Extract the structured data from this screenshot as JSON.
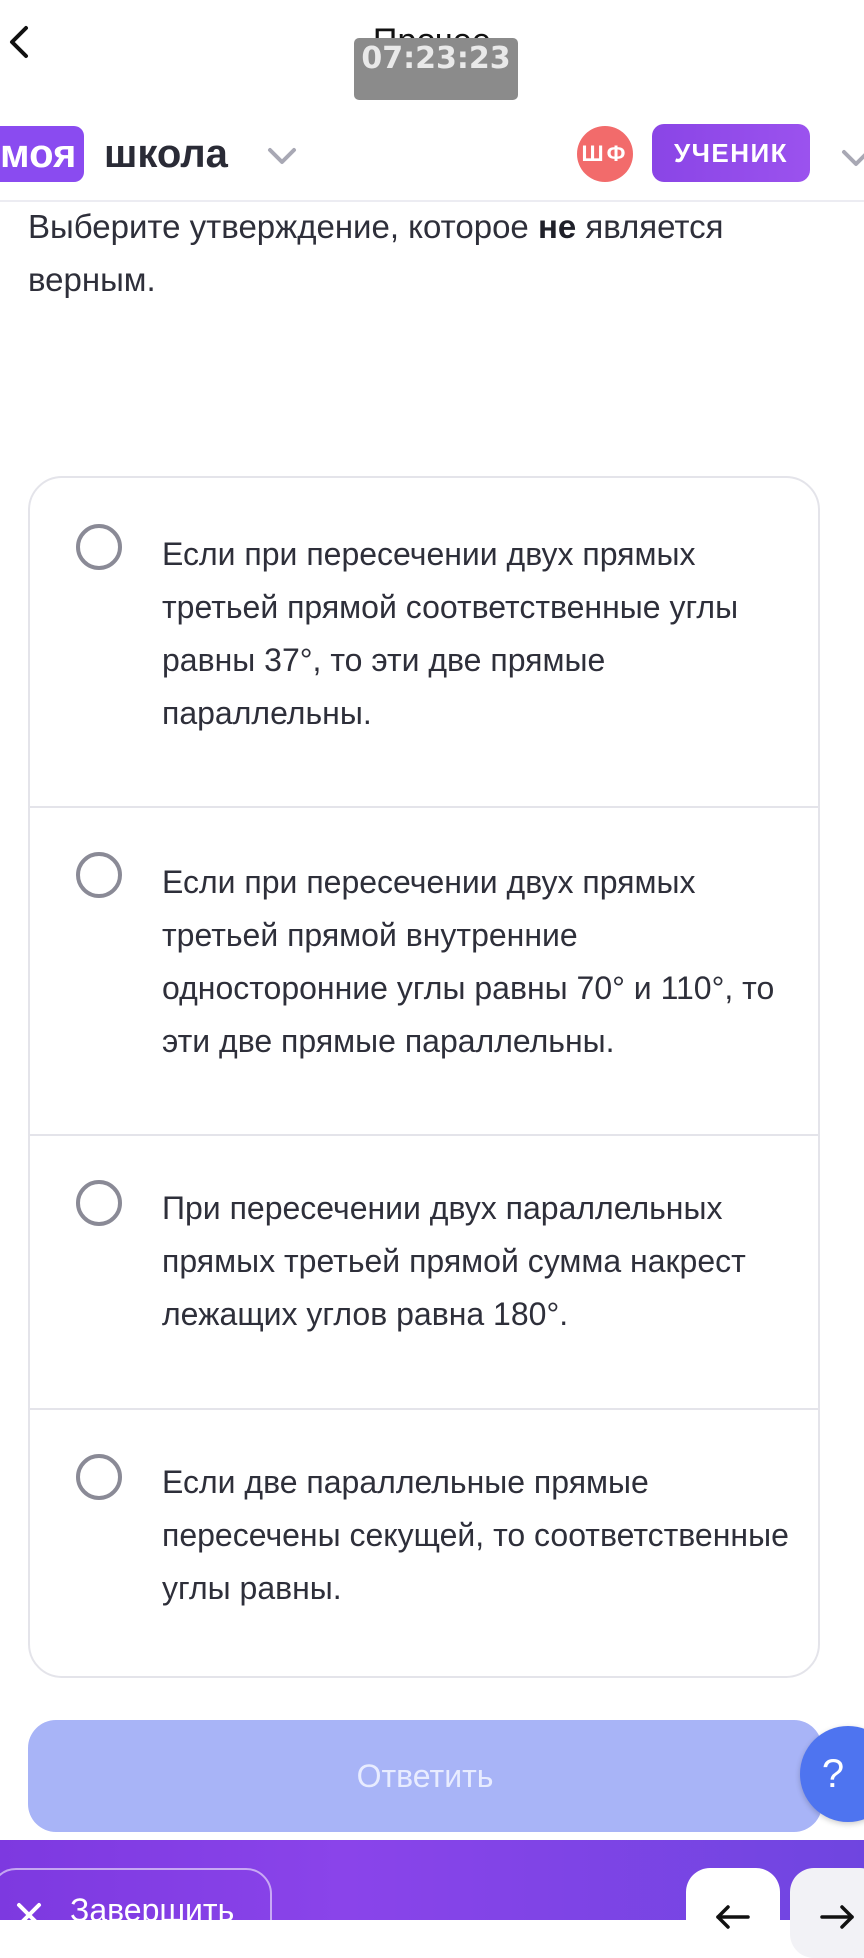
{
  "topbar": {
    "title": "Прочее",
    "timer": "07:23:23"
  },
  "header": {
    "logo_badge": "моя",
    "logo_rest": "школа",
    "avatar_initials": "ШФ",
    "role_label": "УЧЕНИК"
  },
  "question": {
    "text_before": "Выберите утверждение, которое ",
    "text_bold": "не",
    "text_after": " является верным."
  },
  "options": [
    {
      "text": "Если при пересечении двух прямых третьей прямой соответственные углы равны 37°, то эти две прямые параллельны."
    },
    {
      "text": "Если при пересечении двух прямых третьей прямой внутренние односторонние углы равны 70° и 110°, то эти две прямые параллельны."
    },
    {
      "text": "При пересечении двух параллельных прямых третьей прямой сумма накрест лежащих углов равна 180°."
    },
    {
      "text": "Если две параллельные прямые пересечены секущей, то соответственные углы равны."
    }
  ],
  "actions": {
    "answer_label": "Ответить",
    "help_label": "?",
    "finish_label": "Завершить"
  },
  "colors": {
    "accent": "#8a4bf0",
    "avatar": "#f26b6b",
    "answer_disabled": "#a8b4f7",
    "help": "#4e74f0"
  }
}
